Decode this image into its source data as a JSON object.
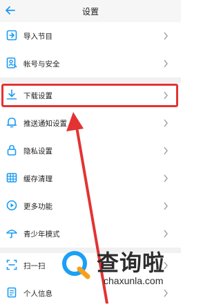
{
  "header": {
    "title": "设置",
    "back_icon": "arrow-left-icon"
  },
  "colors": {
    "accent": "#1a9bf0",
    "highlight": "#e43232"
  },
  "menu_group1": [
    {
      "label": "导入节目",
      "icon": "import-icon"
    },
    {
      "label": "帐号与安全",
      "icon": "account-security-icon"
    }
  ],
  "menu_group2": [
    {
      "label": "下载设置",
      "icon": "download-icon"
    },
    {
      "label": "推送通知设置",
      "icon": "bell-icon"
    },
    {
      "label": "隐私设置",
      "icon": "lock-icon"
    },
    {
      "label": "缓存清理",
      "icon": "cache-icon"
    },
    {
      "label": "更多功能",
      "icon": "play-circle-icon"
    },
    {
      "label": "青少年模式",
      "icon": "umbrella-icon"
    }
  ],
  "menu_group3": [
    {
      "label": "扫一扫",
      "icon": "scan-icon"
    },
    {
      "label": "个人信息",
      "icon": "document-icon"
    }
  ],
  "watermark": {
    "name": "查询啦",
    "url": "chaxunla.com"
  }
}
